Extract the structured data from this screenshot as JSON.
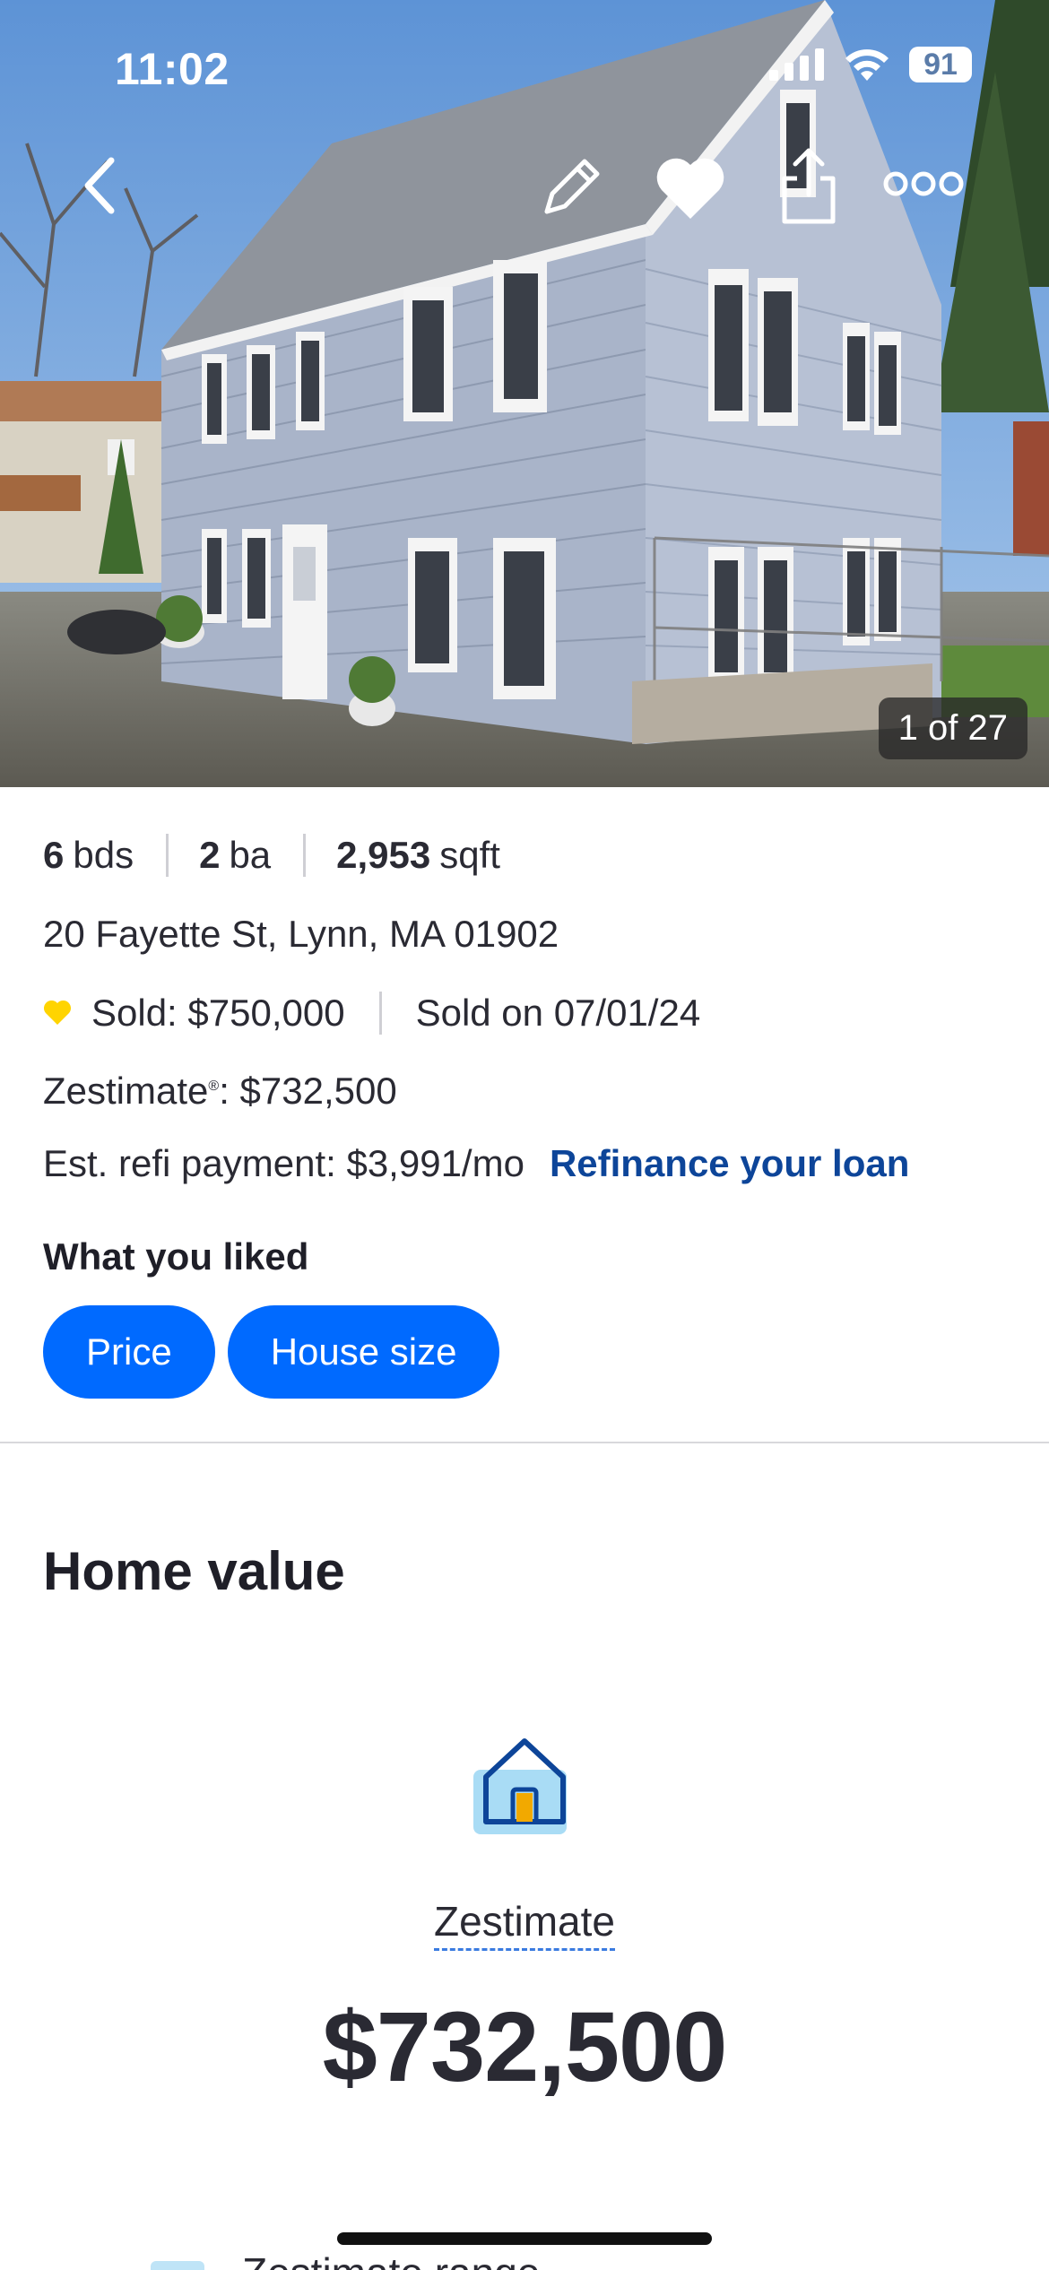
{
  "status_bar": {
    "time": "11:02",
    "battery": "91"
  },
  "toolbar": {
    "back_icon": "chevron-left-icon",
    "edit_icon": "pencil-icon",
    "save_icon": "heart-icon",
    "share_icon": "share-icon",
    "more_icon": "more-dots-icon"
  },
  "photo": {
    "counter": "1 of 27"
  },
  "facts": {
    "beds_value": "6",
    "beds_unit": "bds",
    "baths_value": "2",
    "baths_unit": "ba",
    "sqft_value": "2,953",
    "sqft_unit": "sqft"
  },
  "address": "20 Fayette St, Lynn, MA 01902",
  "sold": {
    "price": "Sold: $750,000",
    "date": "Sold on 07/01/24",
    "heart_color": "#ffd400"
  },
  "zestimate_line": {
    "label": "Zestimate",
    "mark": "®",
    "value": ": $732,500"
  },
  "refi": {
    "text": "Est. refi payment: $3,991/mo",
    "link": "Refinance your loan"
  },
  "liked": {
    "title": "What you liked",
    "chips": [
      "Price",
      "House size"
    ]
  },
  "home_value": {
    "title": "Home value",
    "label": "Zestimate",
    "amount": "$732,500",
    "range_label": "Zestimate range"
  },
  "colors": {
    "accent": "#006aff",
    "link": "#0d4599"
  }
}
